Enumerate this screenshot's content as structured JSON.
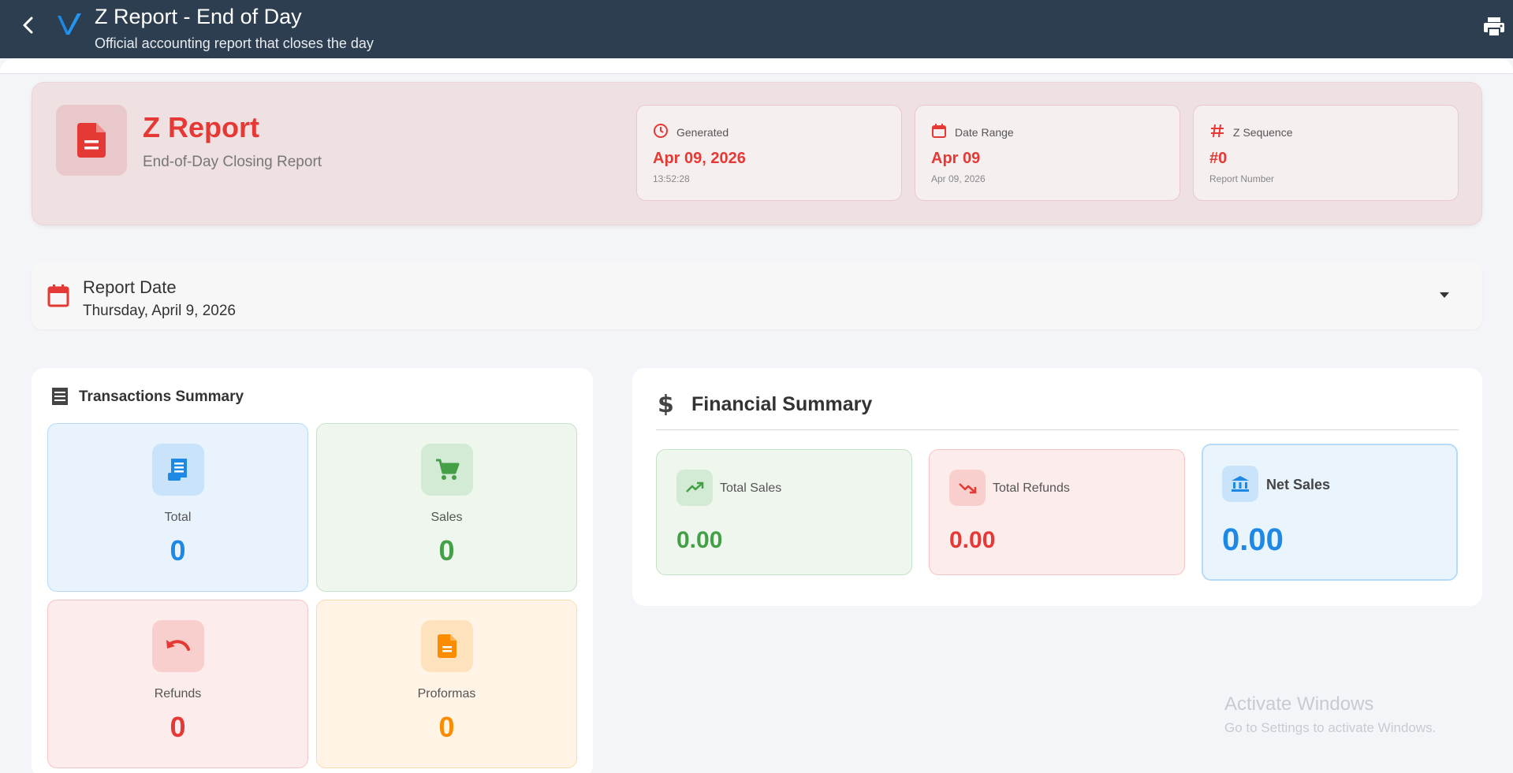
{
  "appbar": {
    "title": "Z Report - End of Day",
    "subtitle": "Official accounting report that closes the day",
    "back_icon": "arrow-back-icon",
    "print_icon": "printer-icon"
  },
  "hero": {
    "title": "Z Report",
    "subtitle": "End-of-Day Closing Report",
    "icon": "document-icon",
    "stats": [
      {
        "label": "Generated",
        "value": "Apr 09, 2026",
        "note": "13:52:28",
        "icon": "clock-icon"
      },
      {
        "label": "Date Range",
        "value": "Apr 09",
        "note": "Apr 09, 2026",
        "icon": "calendar-icon"
      },
      {
        "label": "Z Sequence",
        "value": "#0",
        "note": "Report Number",
        "icon": "hash-icon"
      }
    ]
  },
  "report_date": {
    "label": "Report Date",
    "value": "Thursday, April 9, 2026"
  },
  "transactions": {
    "title": "Transactions Summary",
    "tiles": [
      {
        "label": "Total",
        "value": "0",
        "color": "#1e88e5",
        "icon": "receipt-icon"
      },
      {
        "label": "Sales",
        "value": "0",
        "color": "#43a047",
        "icon": "cart-icon"
      },
      {
        "label": "Refunds",
        "value": "0",
        "color": "#e53935",
        "icon": "undo-icon"
      },
      {
        "label": "Proformas",
        "value": "0",
        "color": "#fb8c00",
        "icon": "document-icon"
      }
    ]
  },
  "financial": {
    "title": "Financial Summary",
    "cards": [
      {
        "label": "Total Sales",
        "value": "0.00",
        "color": "#43a047",
        "icon": "trending-up-icon"
      },
      {
        "label": "Total Refunds",
        "value": "0.00",
        "color": "#e53935",
        "icon": "trending-down-icon"
      },
      {
        "label": "Net Sales",
        "value": "0.00",
        "color": "#1e88e5",
        "icon": "bank-icon"
      }
    ]
  },
  "watermark": {
    "line1": "Activate Windows",
    "line2": "Go to Settings to activate Windows."
  },
  "colors": {
    "appbar": "#2c3e50",
    "accent_red": "#e53935",
    "green": "#43a047",
    "blue": "#1e88e5",
    "orange": "#fb8c00"
  }
}
